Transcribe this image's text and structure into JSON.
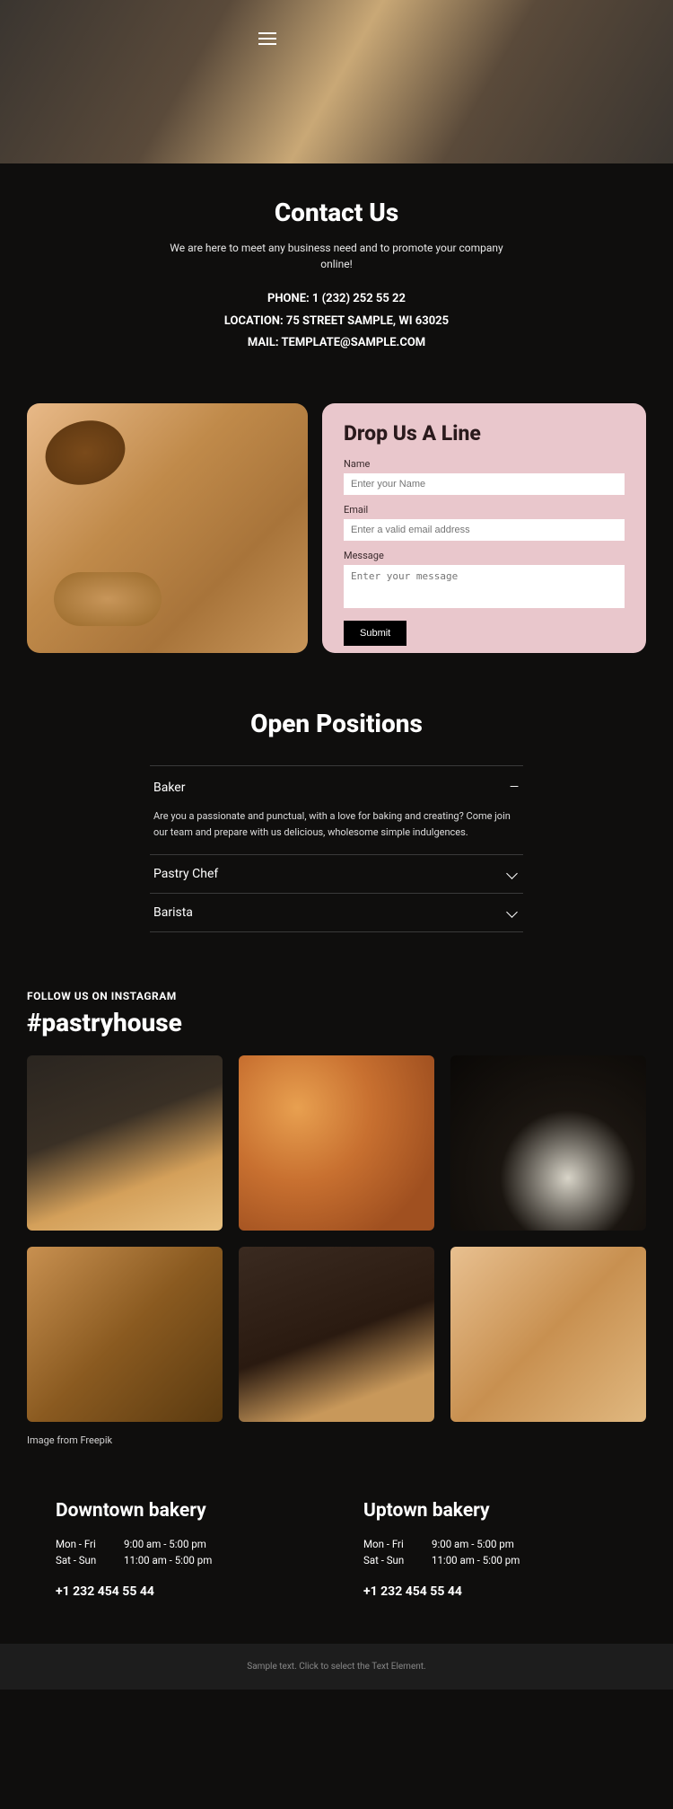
{
  "contact": {
    "title": "Contact Us",
    "tagline": "We are here to meet any business need and to promote your company online!",
    "phone": "PHONE: 1 (232) 252 55 22",
    "location": "LOCATION: 75 STREET SAMPLE, WI 63025",
    "mail": "MAIL: TEMPLATE@SAMPLE.COM"
  },
  "form": {
    "title": "Drop Us A Line",
    "name_label": "Name",
    "name_placeholder": "Enter your Name",
    "email_label": "Email",
    "email_placeholder": "Enter a valid email address",
    "message_label": "Message",
    "message_placeholder": "Enter your message",
    "submit": "Submit"
  },
  "positions": {
    "title": "Open Positions",
    "items": [
      {
        "title": "Baker",
        "open": true,
        "body": "Are you a passionate and punctual, with a love for baking and creating? Come join our team and prepare with us delicious, wholesome simple indulgences."
      },
      {
        "title": "Pastry Chef",
        "open": false
      },
      {
        "title": "Barista",
        "open": false
      }
    ]
  },
  "insta": {
    "follow": "FOLLOW US ON INSTAGRAM",
    "hashtag": "#pastryhouse",
    "credit": "Image from Freepik"
  },
  "locations": {
    "a": {
      "name": "Downtown bakery",
      "h1d": "Mon - Fri",
      "h1t": "9:00 am - 5:00 pm",
      "h2d": "Sat - Sun",
      "h2t": "11:00 am - 5:00 pm",
      "phone": "+1 232 454 55 44"
    },
    "b": {
      "name": "Uptown bakery",
      "h1d": "Mon - Fri",
      "h1t": "9:00 am - 5:00 pm",
      "h2d": "Sat - Sun",
      "h2t": "11:00 am - 5:00 pm",
      "phone": "+1 232 454 55 44"
    }
  },
  "footer": "Sample text. Click to select the Text Element."
}
